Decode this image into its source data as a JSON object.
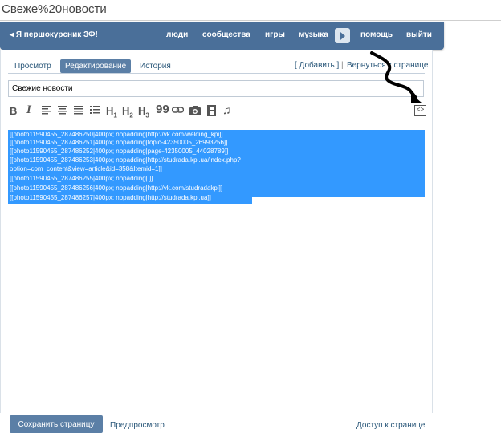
{
  "address_bar": {
    "text": "Свеже%20новости"
  },
  "header": {
    "back_label": "Я першокурсник ЗФ!",
    "menu": [
      "люди",
      "сообщества",
      "игры",
      "музыка",
      "помощь",
      "выйти"
    ]
  },
  "tabs": [
    "Просмотр",
    "Редактирование",
    "История"
  ],
  "right_links": {
    "add": "[ Добавить ]",
    "separator": "|",
    "back": "Вернуться к странице"
  },
  "title_field": {
    "value": "Свежие новости"
  },
  "toolbar": {
    "bold": "B",
    "italic": "I",
    "icons": [
      "bold-icon",
      "italic-icon",
      "align-left-icon",
      "align-center-icon",
      "list-icon",
      "heading1-icon",
      "heading2-icon",
      "heading3-icon",
      "quote-icon",
      "link-icon",
      "photo-icon",
      "video-icon",
      "audio-icon",
      "source-mode-icon"
    ],
    "h1": "H",
    "h2": "H",
    "h3": "H",
    "quote": "99",
    "source": "<>"
  },
  "editor": {
    "lines": [
      "[[photo11590455_287486250|400px; nopadding|http://vk.com/welding_kpi]]",
      "[[photo11590455_287486251|400px; nopadding|topic-42350005_26993256]]",
      "[[photo11590455_287486252|400px; nopadding|page-42350005_44028789]]",
      "[[photo11590455_287486253|400px; nopadding|http://studrada.kpi.ua/index.php?",
      "option=com_content&view=article&id=358&Itemid=1]]",
      "[[photo11590455_287486255|400px; nopadding| ]]",
      "[[photo11590455_287486256|400px; nopadding|http://vk.com/studradakpi]]",
      "[[photo11590455_287486257|400px; nopadding|http://studrada.kpi.ua]]"
    ]
  },
  "footer": {
    "save": "Сохранить страницу",
    "preview": "Предпросмотр",
    "access": "Доступ к странице"
  },
  "colors": {
    "header": "#4a6f99",
    "selection": "#3399ff",
    "button": "#5b7fa6",
    "link": "#2b587a"
  }
}
